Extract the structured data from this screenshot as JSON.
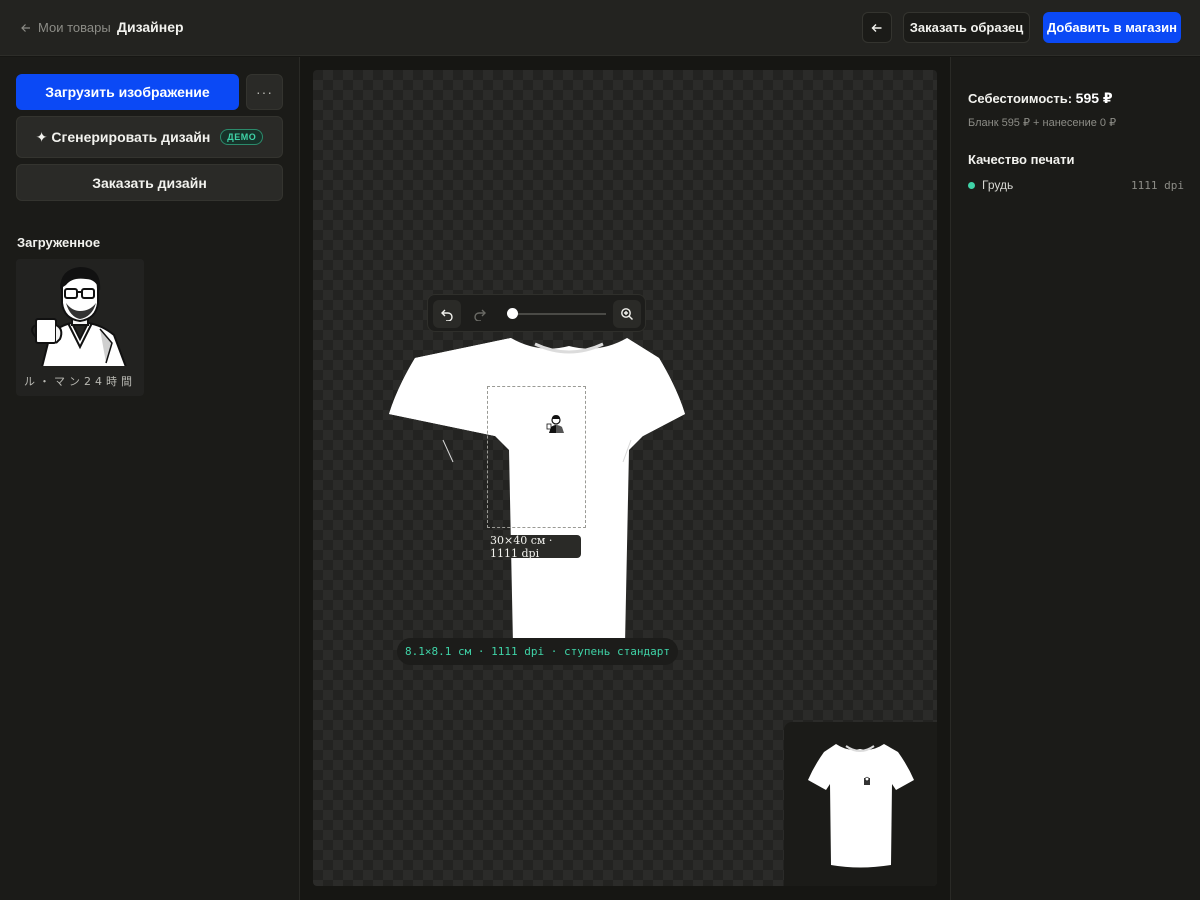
{
  "topbar": {
    "back_label": "Мои товары",
    "title": "Дизайнер",
    "order_sample_label": "Заказать образец",
    "add_to_store_label": "Добавить в магазин"
  },
  "left_panel": {
    "upload_label": "Загрузить изображение",
    "more_label": "···",
    "generate_label": "✦ Сгенерировать дизайн",
    "demo_badge": "ДЕМО",
    "order_design_label": "Заказать дизайн",
    "uploaded_title": "Загруженное",
    "uploaded_items": [
      {
        "caption": "ル・マン24時間"
      }
    ]
  },
  "canvas": {
    "print_area_label": "30×40 см · 1111 dpi",
    "info_label": "8.1×8.1 см · 1111 dpi · ступень стандарт",
    "zoom_level": 0
  },
  "right_panel": {
    "cost_label": "Себестоимость:",
    "cost_value": "595 ₽",
    "cost_breakdown": "Бланк 595 ₽ + нанесение 0 ₽",
    "quality_title": "Качество печати",
    "quality_items": [
      {
        "label": "Грудь",
        "dpi": "1111 dpi",
        "status_color": "#3fd3a7"
      }
    ]
  },
  "colors": {
    "accent": "#0b49f5",
    "status_ok": "#3fd3a7",
    "background": "#161613"
  }
}
